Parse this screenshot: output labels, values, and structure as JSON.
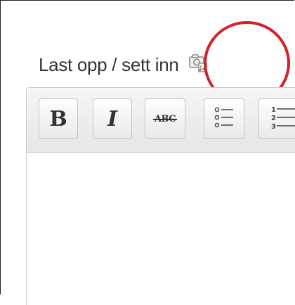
{
  "upload": {
    "label": "Last opp / sett inn",
    "icon": "media-upload-icon"
  },
  "highlight": {
    "color": "#d2232a"
  },
  "toolbar": {
    "buttons": [
      {
        "name": "bold",
        "label": "B"
      },
      {
        "name": "italic",
        "label": "I"
      },
      {
        "name": "strikethrough",
        "label": "ABC"
      },
      {
        "name": "bullet-list",
        "icon": "bullet-list-icon"
      },
      {
        "name": "numbered-list",
        "icon": "numbered-list-icon",
        "numbers": [
          "1",
          "2",
          "3"
        ]
      }
    ]
  }
}
